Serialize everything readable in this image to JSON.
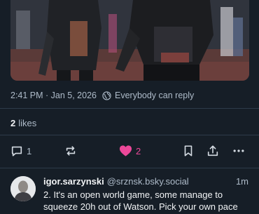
{
  "post": {
    "timestamp": "2:41 PM · Jan 5, 2026",
    "reply_setting": "Everybody can reply",
    "likes_count": "2",
    "likes_label": "likes"
  },
  "actions": {
    "reply_count": "1",
    "like_count": "2",
    "like_color": "#ec4899"
  },
  "reply": {
    "author_name": "igor.sarzynski",
    "author_handle": "@srznsk.bsky.social",
    "time": "1m",
    "text": "2. It's an open world game, some manage to squeeze 20h out of Watson. Pick your own pace"
  }
}
